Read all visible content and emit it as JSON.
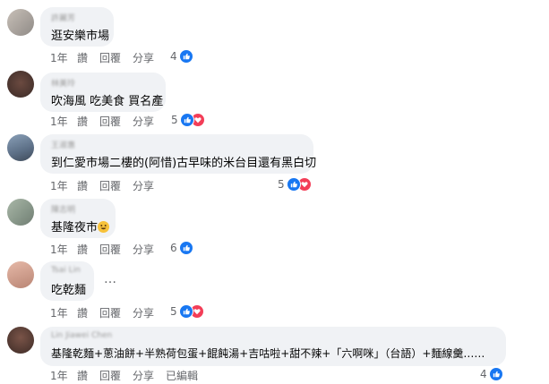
{
  "comments": [
    {
      "name": "許麗芳",
      "text": "逛安樂市場",
      "time": "1年",
      "like": "讚",
      "reply": "回覆",
      "share": "分享",
      "reactions": "4",
      "types": [
        "like"
      ]
    },
    {
      "name": "林美玲",
      "text": "吹海風 吃美食 買名產",
      "time": "1年",
      "like": "讚",
      "reply": "回覆",
      "share": "分享",
      "reactions": "5",
      "types": [
        "like",
        "love"
      ]
    },
    {
      "name": "王淑惠",
      "text": "到仁愛市場二樓的(阿惜)古早味的米台目還有黑白切",
      "time": "1年",
      "like": "讚",
      "reply": "回覆",
      "share": "分享",
      "reactions": "5",
      "types": [
        "like",
        "love"
      ]
    },
    {
      "name": "陳志明",
      "text": "基隆夜市",
      "time": "1年",
      "like": "讚",
      "reply": "回覆",
      "share": "分享",
      "reactions": "6",
      "types": [
        "like"
      ]
    },
    {
      "name": "Tsai Lin",
      "text": "吃乾麵",
      "time": "1年",
      "like": "讚",
      "reply": "回覆",
      "share": "分享",
      "reactions": "5",
      "types": [
        "like",
        "love"
      ]
    },
    {
      "name": "Lin Jiawei Chen",
      "text": "基隆乾麵+蔥油餅+半熟荷包蛋+餛飩湯+吉咕啦+甜不辣+「六啊咪」（台語）+麵線羹……",
      "time": "1年",
      "like": "讚",
      "reply": "回覆",
      "share": "分享",
      "edited": "已編輯",
      "reactions": "4",
      "types": [
        "like"
      ]
    }
  ],
  "more_options": "…",
  "colors": {
    "like": "#1877f2",
    "love": "#f33e58",
    "bubble": "#f0f2f5"
  },
  "icons": {
    "like": "thumbs-up-icon",
    "love": "heart-icon",
    "emoji": "grinning-face-emoji"
  }
}
